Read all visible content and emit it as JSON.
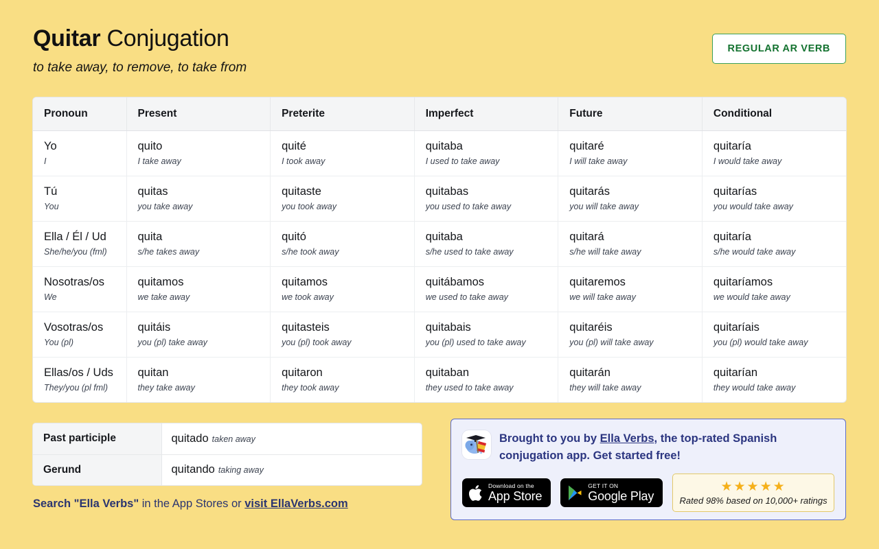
{
  "header": {
    "verb": "Quitar",
    "title_rest": " Conjugation",
    "translation": "to take away, to remove, to take from",
    "badge": "REGULAR AR VERB"
  },
  "table": {
    "columns": [
      "Pronoun",
      "Present",
      "Preterite",
      "Imperfect",
      "Future",
      "Conditional"
    ],
    "rows": [
      {
        "pronoun": "Yo",
        "pronoun_gloss": "I",
        "present": "quito",
        "present_gloss": "I take away",
        "preterite": "quité",
        "preterite_gloss": "I took away",
        "imperfect": "quitaba",
        "imperfect_gloss": "I used to take away",
        "future": "quitaré",
        "future_gloss": "I will take away",
        "conditional": "quitaría",
        "conditional_gloss": "I would take away"
      },
      {
        "pronoun": "Tú",
        "pronoun_gloss": "You",
        "present": "quitas",
        "present_gloss": "you take away",
        "preterite": "quitaste",
        "preterite_gloss": "you took away",
        "imperfect": "quitabas",
        "imperfect_gloss": "you used to take away",
        "future": "quitarás",
        "future_gloss": "you will take away",
        "conditional": "quitarías",
        "conditional_gloss": "you would take away"
      },
      {
        "pronoun": "Ella / Él / Ud",
        "pronoun_gloss": "She/he/you (fml)",
        "present": "quita",
        "present_gloss": "s/he takes away",
        "preterite": "quitó",
        "preterite_gloss": "s/he took away",
        "imperfect": "quitaba",
        "imperfect_gloss": "s/he used to take away",
        "future": "quitará",
        "future_gloss": "s/he will take away",
        "conditional": "quitaría",
        "conditional_gloss": "s/he would take away"
      },
      {
        "pronoun": "Nosotras/os",
        "pronoun_gloss": "We",
        "present": "quitamos",
        "present_gloss": "we take away",
        "preterite": "quitamos",
        "preterite_gloss": "we took away",
        "imperfect": "quitábamos",
        "imperfect_gloss": "we used to take away",
        "future": "quitaremos",
        "future_gloss": "we will take away",
        "conditional": "quitaríamos",
        "conditional_gloss": "we would take away"
      },
      {
        "pronoun": "Vosotras/os",
        "pronoun_gloss": "You (pl)",
        "present": "quitáis",
        "present_gloss": "you (pl) take away",
        "preterite": "quitasteis",
        "preterite_gloss": "you (pl) took away",
        "imperfect": "quitabais",
        "imperfect_gloss": "you (pl) used to take away",
        "future": "quitaréis",
        "future_gloss": "you (pl) will take away",
        "conditional": "quitaríais",
        "conditional_gloss": "you (pl) would take away"
      },
      {
        "pronoun": "Ellas/os / Uds",
        "pronoun_gloss": "They/you (pl fml)",
        "present": "quitan",
        "present_gloss": "they take away",
        "preterite": "quitaron",
        "preterite_gloss": "they took away",
        "imperfect": "quitaban",
        "imperfect_gloss": "they used to take away",
        "future": "quitarán",
        "future_gloss": "they will take away",
        "conditional": "quitarían",
        "conditional_gloss": "they would take away"
      }
    ]
  },
  "forms": {
    "past_participle_label": "Past participle",
    "past_participle_value": "quitado",
    "past_participle_gloss": "taken away",
    "gerund_label": "Gerund",
    "gerund_value": "quitando",
    "gerund_gloss": "taking away"
  },
  "search_line": {
    "bold_1": "Search \"Ella Verbs\"",
    "plain": " in the App Stores or ",
    "link": "visit EllaVerbs.com"
  },
  "promo": {
    "text_1": "Brought to you by ",
    "link": "Ella Verbs",
    "text_2": ", the top-rated Spanish conjugation app. Get started free!",
    "app_store_small": "Download on the",
    "app_store_big": "App Store",
    "google_play_small": "GET IT ON",
    "google_play_big": "Google Play",
    "stars": "★★★★★",
    "rating_text": "Rated 98% based on 10,000+ ratings"
  },
  "colors": {
    "background": "#f9de84",
    "badge_green": "#13722f",
    "promo_navy": "#2b3580",
    "promo_bg": "#eef0fb",
    "star_gold": "#f5b01a"
  }
}
